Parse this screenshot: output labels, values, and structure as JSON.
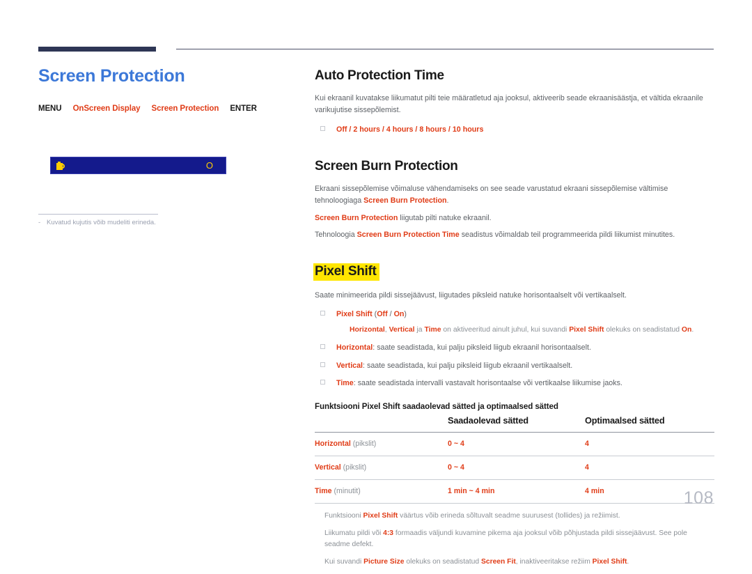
{
  "document": {
    "page_number": "108"
  },
  "left": {
    "title": "Screen Protection",
    "nav": [
      {
        "label": "MENU",
        "type": "key"
      },
      {
        "label": "OnScreen Display",
        "type": "item"
      },
      {
        "label": "Screen Protection",
        "type": "item"
      },
      {
        "label": "ENTER",
        "type": "key"
      }
    ],
    "osd": {
      "icon": "folder-icon",
      "right_glyph": "O",
      "bg_color": "#141a8c",
      "accent_color": "#ffcc00"
    },
    "footnote": {
      "dash": "-",
      "text": "Kuvatud kujutis võib mudeliti erineda."
    }
  },
  "main": {
    "auto_protection": {
      "heading": "Auto Protection Time",
      "paragraph": "Kui ekraanil kuvatakse liikumatut pilti teie määratletud aja jooksul, aktiveerib seade ekraanisäästja, et vältida ekraanile varikujutise sissepõlemist.",
      "options": [
        {
          "label": "Off",
          "emph": true
        },
        {
          "sep": "/"
        },
        {
          "label": "2 hours",
          "emph": true
        },
        {
          "sep": "/"
        },
        {
          "label": "4 hours",
          "emph": true
        },
        {
          "sep": "/"
        },
        {
          "label": "8 hours",
          "emph": true
        },
        {
          "sep": "/"
        },
        {
          "label": "10 hours",
          "emph": true
        }
      ],
      "options_plain": "Off / 2 hours / 4 hours / 8 hours / 10 hours"
    },
    "screen_burn": {
      "heading": "Screen Burn Protection",
      "p1_a": "Ekraani sissepõlemise võimaluse vähendamiseks on see seade varustatud ekraani sissepõlemise vältimise tehnoloogiaga ",
      "p1_b": "Screen Burn Protection",
      "p1_c": ".",
      "p2_a": "Screen Burn Protection",
      "p2_b": " liigutab pilti natuke ekraanil.",
      "p3_a": "Tehnoloogia ",
      "p3_b": "Screen Burn Protection Time",
      "p3_c": " seadistus võimaldab teil programmeerida pildi liikumist minutites."
    },
    "pixel_shift": {
      "heading": "Pixel Shift",
      "highlight_color": "#ffe600",
      "paragraph": "Saate minimeerida pildi sissejäävust, liigutades piksleid natuke horisontaalselt või vertikaalselt.",
      "bullets": [
        {
          "term": "Pixel Shift",
          "rest_a": " (",
          "opt1": "Off",
          "slash": " / ",
          "opt2": "On",
          "rest_b": ")"
        }
      ],
      "subnote": {
        "t1": "Horizontal",
        "c1": ", ",
        "t2": "Vertical",
        "c2": " ja ",
        "t3": "Time",
        "c3": " on aktiveeritud ainult juhul, kui suvandi ",
        "t4": "Pixel Shift",
        "c4": " olekuks on seadistatud ",
        "t5": "On",
        "c5": "."
      },
      "items": [
        {
          "term": "Horizontal",
          "desc": ": saate seadistada, kui palju piksleid liigub ekraanil horisontaalselt."
        },
        {
          "term": "Vertical",
          "desc": ": saate seadistada, kui palju piksleid liigub ekraanil vertikaalselt."
        },
        {
          "term": "Time",
          "desc": ": saate seadistada intervalli vastavalt horisontaalse või vertikaalse liikumise jaoks."
        }
      ]
    },
    "table": {
      "caption": "Funktsiooni Pixel Shift saadaolevad sätted ja optimaalsed sätted",
      "headers": [
        "",
        "Saadaolevad sätted",
        "Optimaalsed sätted"
      ],
      "rows": [
        {
          "label": "Horizontal",
          "unit": "(pikslit)",
          "available": "0 ~ 4",
          "optimal": "4"
        },
        {
          "label": "Vertical",
          "unit": "(pikslit)",
          "available": "0 ~ 4",
          "optimal": "4"
        },
        {
          "label": "Time",
          "unit": "(minutit)",
          "available": "1 min ~ 4 min",
          "optimal": "4 min"
        }
      ]
    },
    "notes": [
      {
        "a": "Funktsiooni ",
        "t1": "Pixel Shift",
        "b": " väärtus võib erineda sõltuvalt seadme suurusest (tollides) ja režiimist.",
        "t2": "",
        "c": ""
      },
      {
        "a": "Liikumatu pildi või ",
        "t1": "4:3",
        "b": " formaadis väljundi kuvamine pikema aja jooksul võib põhjustada pildi sissejäävust. See pole seadme defekt.",
        "t2": "",
        "c": ""
      },
      {
        "a": "Kui suvandi ",
        "t1": "Picture Size",
        "b": " olekuks on seadistatud ",
        "t2": "Screen Fit",
        "c": ", inaktiveeritakse režiim ",
        "t3": "Pixel Shift",
        "d": "."
      }
    ]
  }
}
